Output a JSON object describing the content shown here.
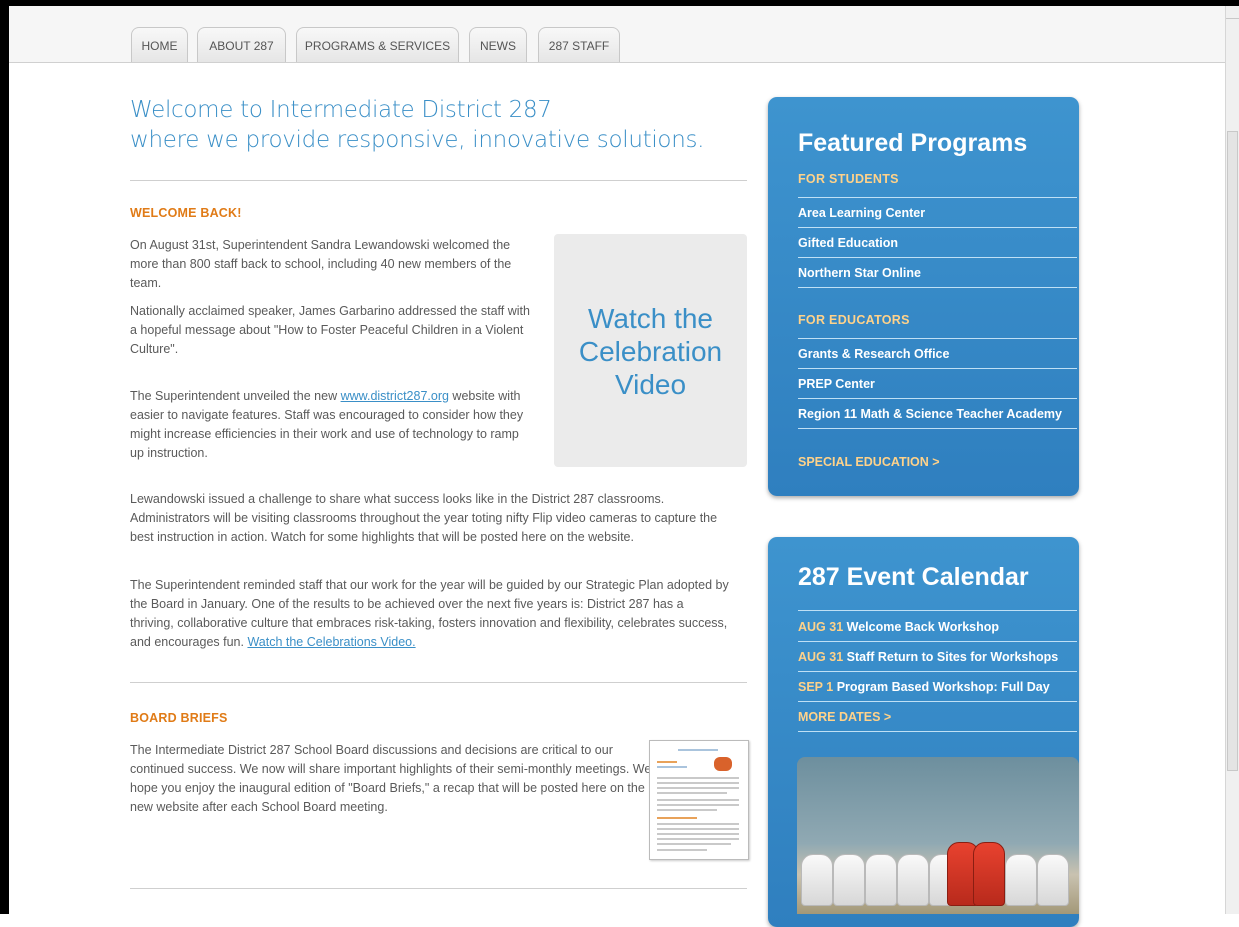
{
  "nav": {
    "tabs": [
      {
        "label": "HOME"
      },
      {
        "label": "ABOUT 287"
      },
      {
        "label": "PROGRAMS & SERVICES"
      },
      {
        "label": "NEWS"
      },
      {
        "label": "287 STAFF"
      }
    ]
  },
  "main": {
    "headline_line1": "Welcome to Intermediate District 287",
    "headline_line2": "where we provide responsive, innovative solutions.",
    "welcome": {
      "title": "WELCOME BACK!",
      "p1": "On August 31st, Superintendent Sandra Lewandowski welcomed the more than 800 staff back to school, including 40 new members of the team.",
      "p2": "Nationally acclaimed speaker, James Garbarino addressed the staff with a hopeful message about \"How to Foster Peaceful Children in a Violent Culture\".",
      "p3_before": "The Superintendent unveiled the new ",
      "p3_link": "www.district287.org",
      "p3_after": " website with easier to navigate features. Staff was encouraged to consider how they might increase efficiencies in their work and use of technology to ramp up instruction.",
      "p4": "Lewandowski issued a challenge to share what success looks like in the District 287 classrooms. Administrators will be visiting classrooms throughout the year toting nifty Flip video cameras to capture the best instruction in action. Watch for some highlights that will be posted here on the website.",
      "p5_before": "The Superintendent reminded staff that our work for the year will be guided by our Strategic Plan adopted by the Board in January. One of the results to be achieved over the next five years is: District 287 has a thriving, collaborative culture that embraces risk-taking, fosters innovation and flexibility, celebrates success, and encourages fun. ",
      "p5_link": "Watch the Celebrations Video."
    },
    "video_box": {
      "line1": "Watch the",
      "line2": "Celebration",
      "line3": "Video"
    },
    "board": {
      "title": "BOARD BRIEFS",
      "p1": "The Intermediate District 287 School Board discussions and decisions are critical to our continued success. We now will share important highlights of their semi-monthly meetings. We hope you enjoy the inaugural edition of \"Board Briefs,\" a recap that will be posted here on the new website after each School Board meeting."
    }
  },
  "featured": {
    "title": "Featured Programs",
    "students_label": "FOR STUDENTS",
    "students": [
      "Area Learning Center",
      "Gifted Education",
      "Northern Star Online"
    ],
    "educators_label": "FOR EDUCATORS",
    "educators": [
      "Grants & Research Office",
      "PREP Center",
      "Region 11 Math & Science Teacher Academy"
    ],
    "special_ed": "SPECIAL EDUCATION >"
  },
  "calendar": {
    "title": "287 Event Calendar",
    "events": [
      {
        "date": "AUG 31",
        "name": "Welcome Back Workshop"
      },
      {
        "date": "AUG 31",
        "name": "Staff Return to Sites for Workshops"
      },
      {
        "date": "SEP 1",
        "name": "Program Based Workshop: Full Day"
      }
    ],
    "more": "MORE DATES >"
  },
  "colors": {
    "accent_blue": "#3a8fc7",
    "section_orange": "#e07b17",
    "panel_blue": "#3a8ecb",
    "panel_label_gold": "#ffd28a"
  }
}
